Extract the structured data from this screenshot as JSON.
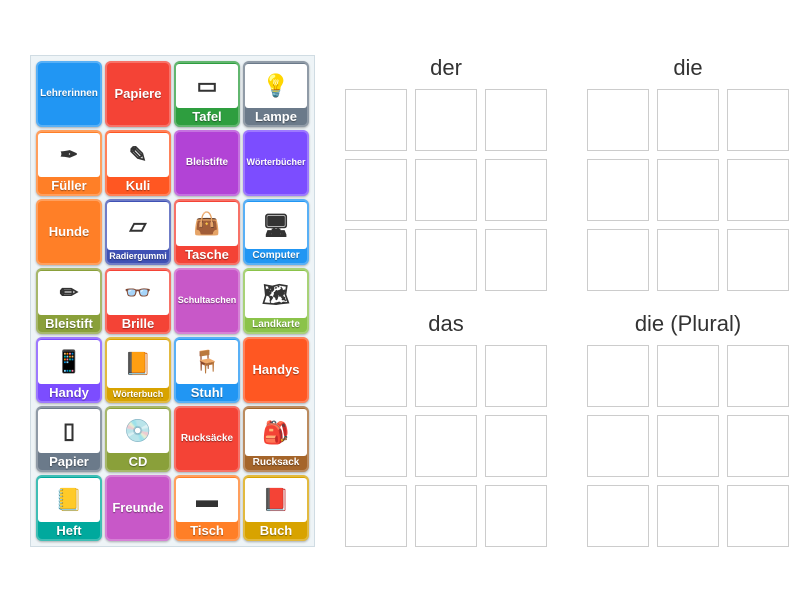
{
  "tiles": [
    {
      "label": "Lehrerinnen",
      "color": "c-blue",
      "img": false,
      "size": "sm"
    },
    {
      "label": "Papiere",
      "color": "c-red",
      "img": false
    },
    {
      "label": "Tafel",
      "color": "c-green",
      "img": true,
      "icon": "▭"
    },
    {
      "label": "Lampe",
      "color": "c-grey",
      "img": true,
      "icon": "💡"
    },
    {
      "label": "Füller",
      "color": "c-orange",
      "img": true,
      "icon": "✒"
    },
    {
      "label": "Kuli",
      "color": "c-dorange",
      "img": true,
      "icon": "✎"
    },
    {
      "label": "Bleistifte",
      "color": "c-purple",
      "img": false,
      "size": "sm"
    },
    {
      "label": "Wörterbücher",
      "color": "c-violet",
      "img": false,
      "size": "xs"
    },
    {
      "label": "Hunde",
      "color": "c-orange",
      "img": false
    },
    {
      "label": "Radiergummi",
      "color": "c-dblue",
      "img": true,
      "icon": "▱",
      "size": "xs"
    },
    {
      "label": "Tasche",
      "color": "c-red",
      "img": true,
      "icon": "👜"
    },
    {
      "label": "Computer",
      "color": "c-blue",
      "img": true,
      "icon": "🖥",
      "size": "sm"
    },
    {
      "label": "Bleistift",
      "color": "c-olive",
      "img": true,
      "icon": "✏"
    },
    {
      "label": "Brille",
      "color": "c-red",
      "img": true,
      "icon": "👓"
    },
    {
      "label": "Schultaschen",
      "color": "c-magenta",
      "img": false,
      "size": "xs"
    },
    {
      "label": "Landkarte",
      "color": "c-lime",
      "img": true,
      "icon": "🗺",
      "size": "sm"
    },
    {
      "label": "Handy",
      "color": "c-violet",
      "img": true,
      "icon": "📱"
    },
    {
      "label": "Wörterbuch",
      "color": "c-yellow",
      "img": true,
      "icon": "📙",
      "size": "xs"
    },
    {
      "label": "Stuhl",
      "color": "c-blue",
      "img": true,
      "icon": "🪑"
    },
    {
      "label": "Handys",
      "color": "c-dorange",
      "img": false
    },
    {
      "label": "Papier",
      "color": "c-grey",
      "img": true,
      "icon": "▯"
    },
    {
      "label": "CD",
      "color": "c-olive",
      "img": true,
      "icon": "💿"
    },
    {
      "label": "Rucksäcke",
      "color": "c-red",
      "img": false,
      "size": "sm"
    },
    {
      "label": "Rucksack",
      "color": "c-brown",
      "img": true,
      "icon": "🎒",
      "size": "sm"
    },
    {
      "label": "Heft",
      "color": "c-teal",
      "img": true,
      "icon": "📒"
    },
    {
      "label": "Freunde",
      "color": "c-magenta",
      "img": false
    },
    {
      "label": "Tisch",
      "color": "c-orange",
      "img": true,
      "icon": "▬"
    },
    {
      "label": "Buch",
      "color": "c-yellow",
      "img": true,
      "icon": "📕"
    }
  ],
  "targets": [
    {
      "title": "der",
      "slots": 9
    },
    {
      "title": "die",
      "slots": 9
    },
    {
      "title": "das",
      "slots": 9
    },
    {
      "title": "die (Plural)",
      "slots": 9
    }
  ]
}
